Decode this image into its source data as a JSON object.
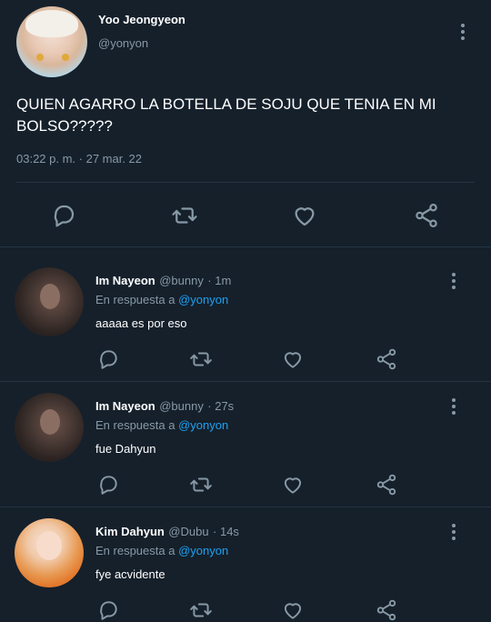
{
  "tweet": {
    "author_name": "Yoo Jeongyeon",
    "author_handle": "@yonyon",
    "text_line1": "QUIEN AGARRO LA BOTELLA DE SOJU QUE TENIA EN MI",
    "text_line2": "BOLSO?????",
    "timestamp": "03:22 p. m. · 27 mar. 22"
  },
  "replies": [
    {
      "name": "Im Nayeon",
      "handle": "@bunny",
      "time": "· 1m",
      "reply_prefix": "En respuesta a",
      "reply_to": "@yonyon",
      "text": "aaaaa es por eso"
    },
    {
      "name": "Im Nayeon",
      "handle": "@bunny",
      "time": "· 27s",
      "reply_prefix": "En respuesta a",
      "reply_to": "@yonyon",
      "text": "fue Dahyun"
    },
    {
      "name": "Kim Dahyun",
      "handle": "@Dubu",
      "time": "· 14s",
      "reply_prefix": "En respuesta a",
      "reply_to": "@yonyon",
      "text": "fye acvidente"
    }
  ],
  "icons": {
    "reply": "reply-icon",
    "retweet": "retweet-icon",
    "like": "like-icon",
    "share": "share-icon",
    "more": "more-icon"
  },
  "colors": {
    "background": "#15202b",
    "muted": "#8899a6",
    "link": "#1da1f2",
    "separator": "#253341"
  }
}
